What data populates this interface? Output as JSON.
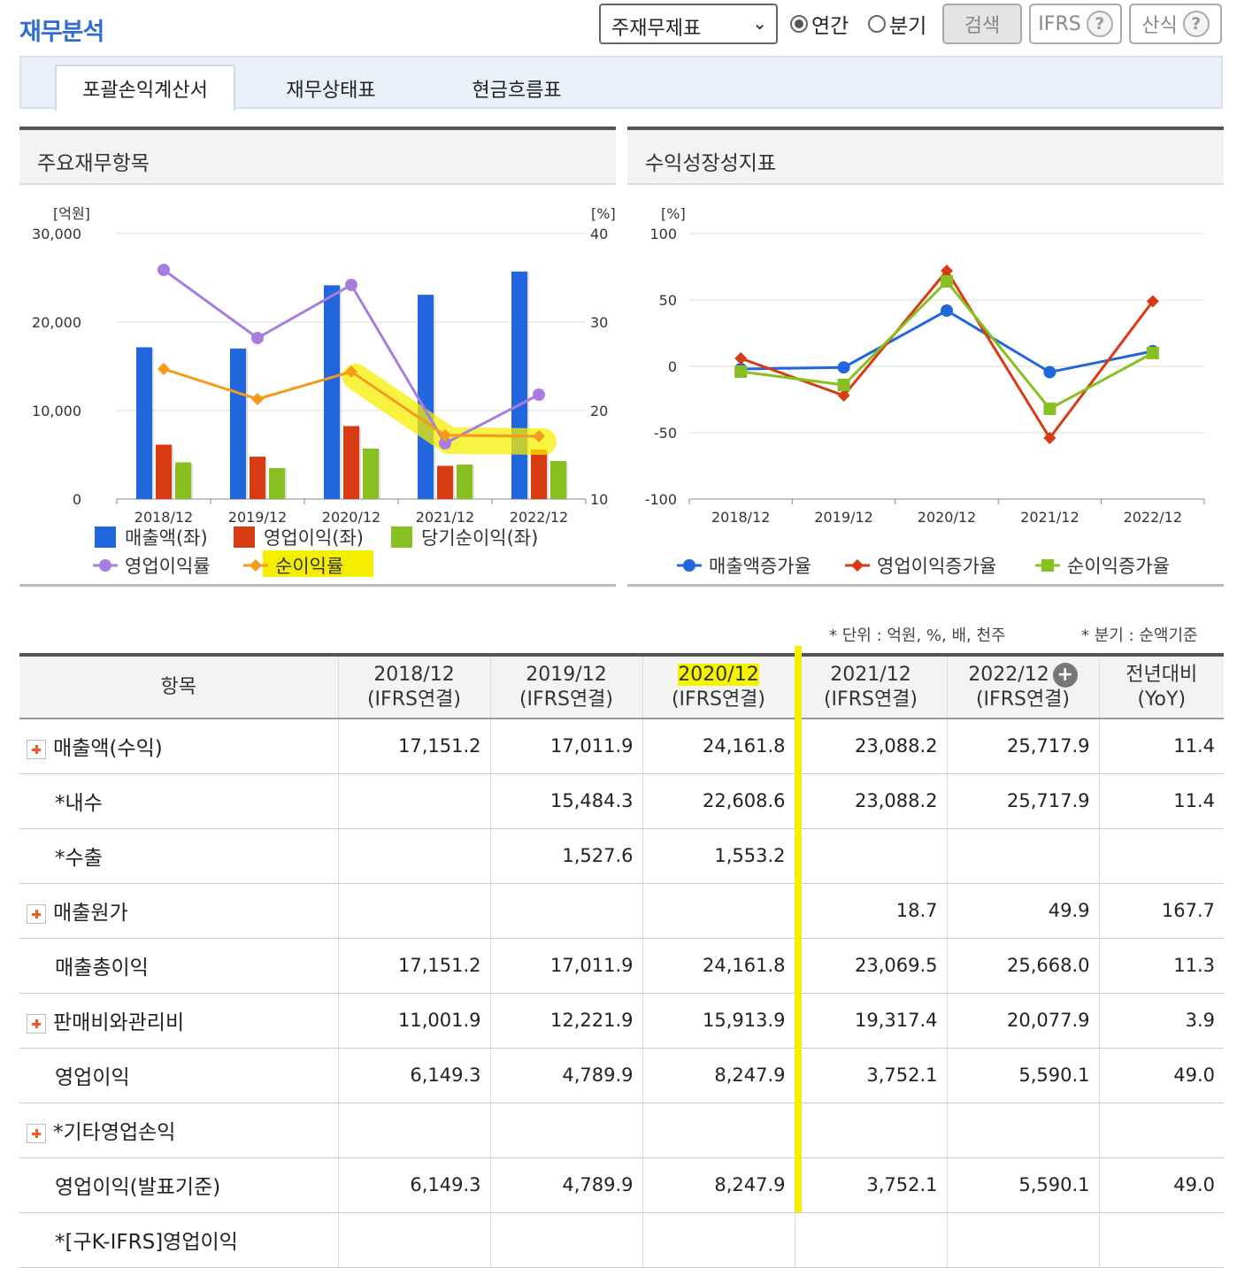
{
  "header": {
    "title": "재무분석",
    "statement_select": "주재무제표",
    "radio_annual": "연간",
    "radio_quarter": "분기",
    "search": "검색",
    "ifrs": "IFRS",
    "formula": "산식",
    "help": "?"
  },
  "tabs": [
    "포괄손익계산서",
    "재무상태표",
    "현금흐름표"
  ],
  "left_panel": {
    "title": "주요재무항목",
    "left_unit": "[억원]",
    "right_unit": "[%]",
    "left_ticks": [
      "30,000",
      "20,000",
      "10,000",
      "0"
    ],
    "right_ticks": [
      "40",
      "30",
      "20",
      "10"
    ],
    "legend": [
      "매출액(좌)",
      "영업이익(좌)",
      "당기순이익(좌)",
      "영업이익률",
      "순이익률"
    ]
  },
  "right_panel": {
    "title": "수익성장성지표",
    "unit": "[%]",
    "ticks": [
      "100",
      "50",
      "0",
      "-50",
      "-100"
    ],
    "legend": [
      "매출액증가율",
      "영업이익증가율",
      "순이익증가율"
    ]
  },
  "notes": {
    "unit": "* 단위 : 억원, %, 배, 천주",
    "quarter": "* 분기 : 순액기준"
  },
  "table": {
    "col_item": "항목",
    "columns": [
      {
        "year": "2018/12",
        "basis": "(IFRS연결)"
      },
      {
        "year": "2019/12",
        "basis": "(IFRS연결)"
      },
      {
        "year": "2020/12",
        "basis": "(IFRS연결)"
      },
      {
        "year": "2021/12",
        "basis": "(IFRS연결)"
      },
      {
        "year": "2022/12",
        "basis": "(IFRS연결)"
      }
    ],
    "col_yoy": {
      "line1": "전년대비",
      "line2": "(YoY)"
    },
    "expand_more": "+",
    "rows": [
      {
        "label": "매출액(수익)",
        "expand": true,
        "indent": false,
        "values": [
          "17,151.2",
          "17,011.9",
          "24,161.8",
          "23,088.2",
          "25,717.9",
          "11.4"
        ]
      },
      {
        "label": "*내수",
        "expand": false,
        "indent": true,
        "values": [
          "",
          "15,484.3",
          "22,608.6",
          "23,088.2",
          "25,717.9",
          "11.4"
        ]
      },
      {
        "label": "*수출",
        "expand": false,
        "indent": true,
        "values": [
          "",
          "1,527.6",
          "1,553.2",
          "",
          "",
          ""
        ]
      },
      {
        "label": "매출원가",
        "expand": true,
        "indent": false,
        "values": [
          "",
          "",
          "",
          "18.7",
          "49.9",
          "167.7"
        ]
      },
      {
        "label": "매출총이익",
        "expand": false,
        "indent": false,
        "values": [
          "17,151.2",
          "17,011.9",
          "24,161.8",
          "23,069.5",
          "25,668.0",
          "11.3"
        ]
      },
      {
        "label": "판매비와관리비",
        "expand": true,
        "indent": false,
        "values": [
          "11,001.9",
          "12,221.9",
          "15,913.9",
          "19,317.4",
          "20,077.9",
          "3.9"
        ]
      },
      {
        "label": "영업이익",
        "expand": false,
        "indent": false,
        "values": [
          "6,149.3",
          "4,789.9",
          "8,247.9",
          "3,752.1",
          "5,590.1",
          "49.0"
        ]
      },
      {
        "label": "*기타영업손익",
        "expand": true,
        "indent": false,
        "values": [
          "",
          "",
          "",
          "",
          "",
          ""
        ]
      },
      {
        "label": "영업이익(발표기준)",
        "expand": false,
        "indent": false,
        "values": [
          "6,149.3",
          "4,789.9",
          "8,247.9",
          "3,752.1",
          "5,590.1",
          "49.0"
        ]
      },
      {
        "label": "*[구K-IFRS]영업이익",
        "expand": false,
        "indent": false,
        "values": [
          "",
          "",
          "",
          "",
          "",
          ""
        ]
      }
    ]
  },
  "colors": {
    "sales": "#2266dd",
    "op_income": "#d83a12",
    "net_income": "#88c022",
    "op_margin": "#a77de0",
    "net_margin": "#f59a1b",
    "highlight": "#f5ee00"
  },
  "chart_data": [
    {
      "type": "bar",
      "categories": [
        "2018/12",
        "2019/12",
        "2020/12",
        "2021/12",
        "2022/12"
      ],
      "ylim": [
        0,
        30000
      ],
      "y2lim": [
        10,
        40
      ],
      "series": [
        {
          "name": "매출액(좌)",
          "axis": "left",
          "type": "bar",
          "values": [
            17151.2,
            17011.9,
            24161.8,
            23088.2,
            25717.9
          ]
        },
        {
          "name": "영업이익(좌)",
          "axis": "left",
          "type": "bar",
          "values": [
            6149.3,
            4789.9,
            8247.9,
            3752.1,
            5590.1
          ]
        },
        {
          "name": "당기순이익(좌)",
          "axis": "left",
          "type": "bar",
          "values": [
            4150,
            3500,
            5700,
            3900,
            4300
          ]
        },
        {
          "name": "영업이익률",
          "axis": "right",
          "type": "line",
          "values": [
            35.9,
            28.2,
            34.2,
            16.3,
            21.8
          ]
        },
        {
          "name": "순이익률",
          "axis": "right",
          "type": "line",
          "values": [
            24.7,
            21.3,
            24.4,
            17.2,
            17.1
          ]
        }
      ]
    },
    {
      "type": "line",
      "categories": [
        "2018/12",
        "2019/12",
        "2020/12",
        "2021/12",
        "2022/12"
      ],
      "ylim": [
        -100,
        100
      ],
      "series": [
        {
          "name": "매출액증가율",
          "values": [
            -2,
            -0.8,
            42,
            -4.4,
            11.4
          ]
        },
        {
          "name": "영업이익증가율",
          "values": [
            6,
            -22,
            72,
            -54,
            49
          ]
        },
        {
          "name": "순이익증가율",
          "values": [
            -4,
            -14,
            64,
            -32,
            10
          ]
        }
      ]
    }
  ]
}
